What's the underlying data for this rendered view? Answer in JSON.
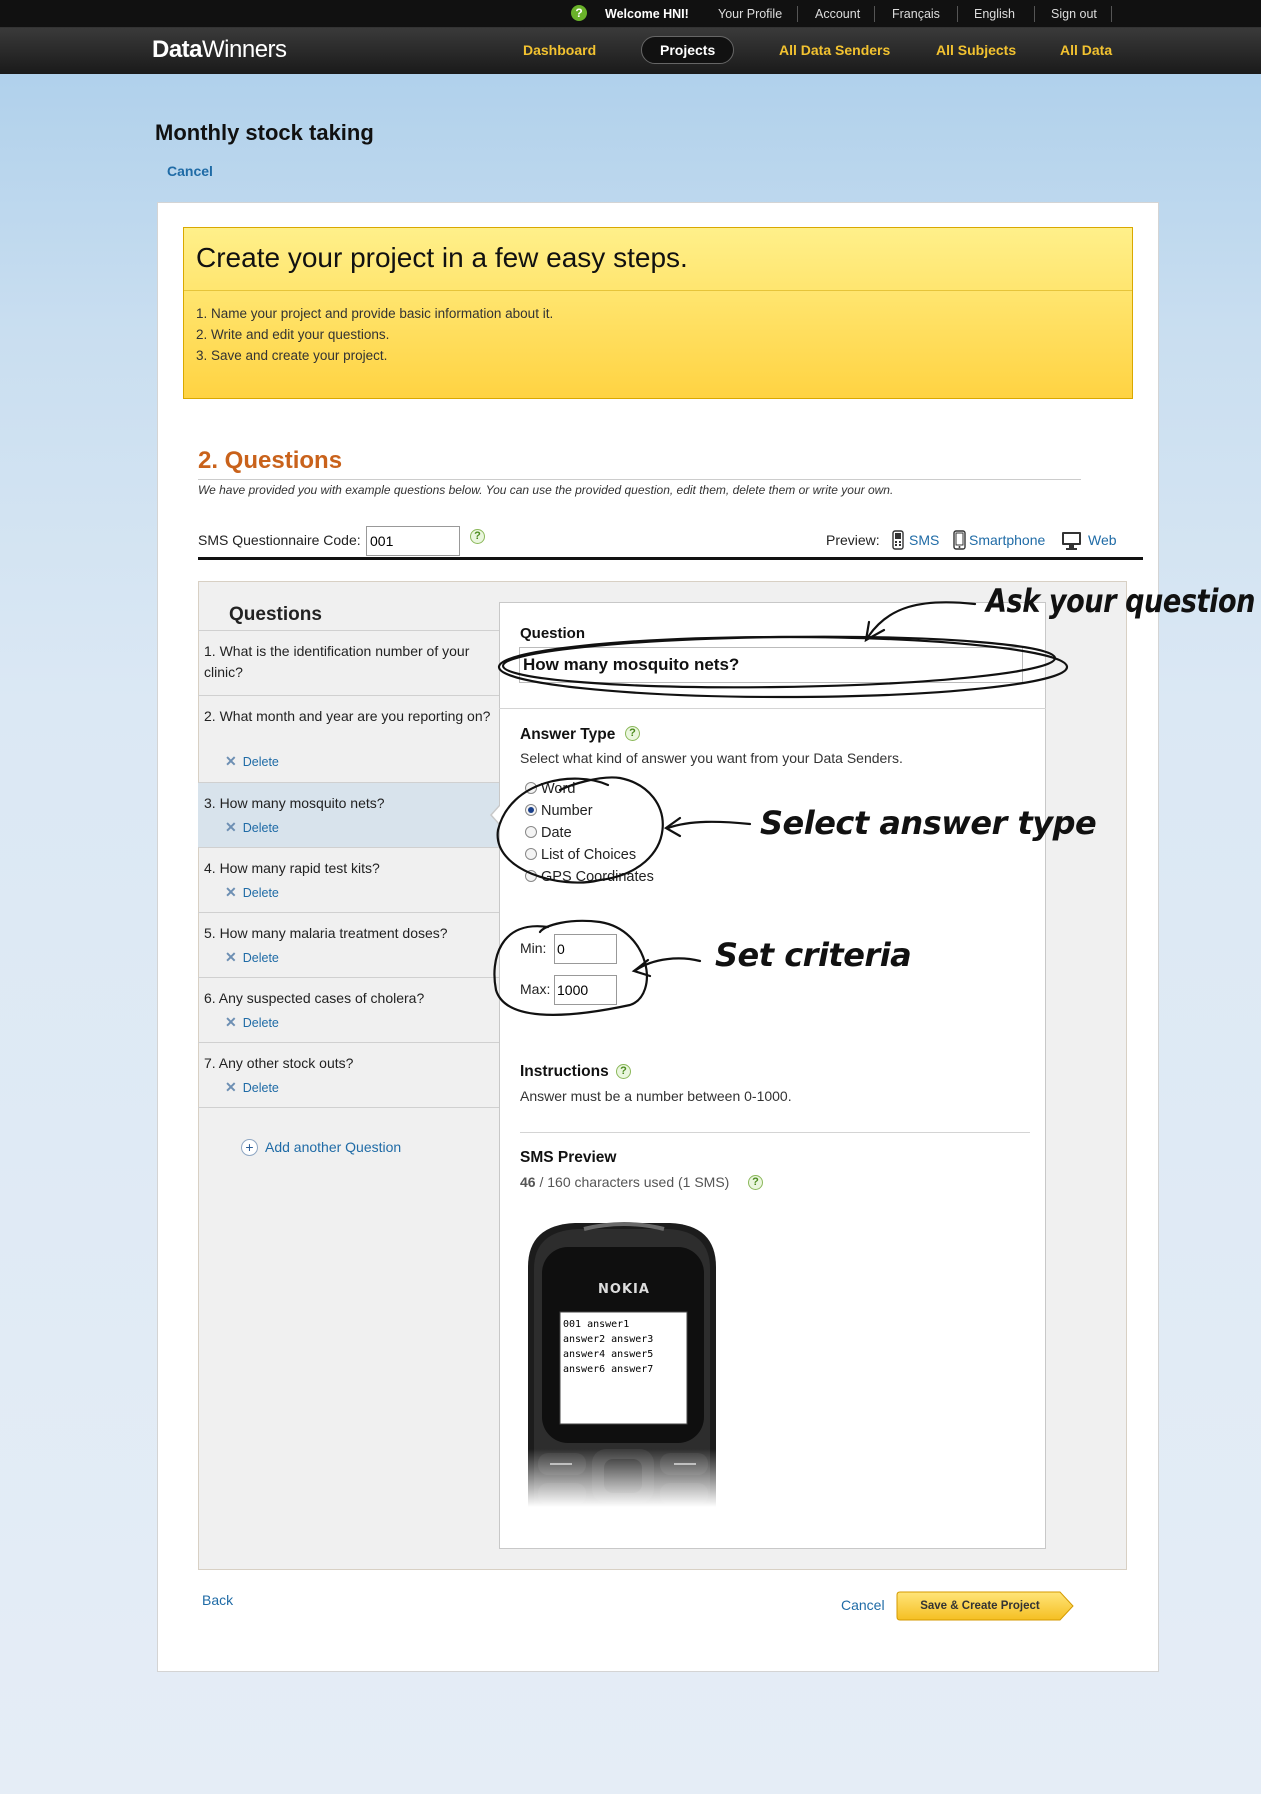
{
  "topbar": {
    "welcome": "Welcome HNI!",
    "links": [
      "Your Profile",
      "Account",
      "Français",
      "English",
      "Sign out"
    ]
  },
  "nav": {
    "logo_bold": "Data",
    "logo_rest": "Winners",
    "items": [
      "Dashboard",
      "Projects",
      "All Data Senders",
      "All Subjects",
      "All Data"
    ],
    "active": "Projects"
  },
  "page": {
    "title": "Monthly stock taking",
    "cancel": "Cancel"
  },
  "steps": {
    "heading": "Create your project in a few easy steps.",
    "items": [
      "1. Name your project and provide basic information about it.",
      "2. Write and edit your questions.",
      "3. Save and create your project."
    ]
  },
  "section": {
    "title": "2. Questions",
    "description": "We have provided you with example questions below. You can use the provided question, edit them, delete them or write your own."
  },
  "sms_code": {
    "label": "SMS Questionnaire Code:",
    "value": "001"
  },
  "preview": {
    "label": "Preview:",
    "links": [
      "SMS",
      "Smartphone",
      "Web"
    ]
  },
  "questions": {
    "heading": "Questions",
    "delete_label": "Delete",
    "selected_index": 2,
    "items": [
      "1. What is the identification number of your clinic?",
      "2. What month and year are you reporting on?",
      "3. How many mosquito nets?",
      "4. How many rapid test kits?",
      "5. How many malaria treatment doses?",
      "6. Any suspected cases of cholera?",
      "7. Any other stock outs?"
    ],
    "add_label": "Add another Question"
  },
  "detail": {
    "question_label": "Question",
    "question_value": "How many mosquito nets?",
    "answer_type_label": "Answer Type",
    "answer_type_hint": "Select what kind of answer you want from your Data Senders.",
    "answer_types": [
      "Word",
      "Number",
      "Date",
      "List of Choices",
      "GPS Coordinates"
    ],
    "answer_type_selected": "Number",
    "min_label": "Min:",
    "min_value": "0",
    "max_label": "Max:",
    "max_value": "1000",
    "instructions_label": "Instructions",
    "instructions_text": "Answer must be a number between 0-1000.",
    "sms_preview_label": "SMS Preview",
    "sms_used": "46",
    "sms_rest": " / 160 characters used (1 SMS)",
    "phone_brand": "NOKIA",
    "phone_screen": [
      "001 answer1",
      "answer2 answer3",
      "answer4 answer5",
      "answer6 answer7"
    ]
  },
  "footer": {
    "back": "Back",
    "cancel": "Cancel",
    "save": "Save & Create Project"
  },
  "annotations": {
    "ask": "Ask your question",
    "select": "Select answer type",
    "criteria": "Set criteria"
  },
  "colors": {
    "nav_accent": "#f2c230",
    "section_title": "#c9621b",
    "link": "#1f6ba6",
    "steps_bg": "#ffd342"
  }
}
